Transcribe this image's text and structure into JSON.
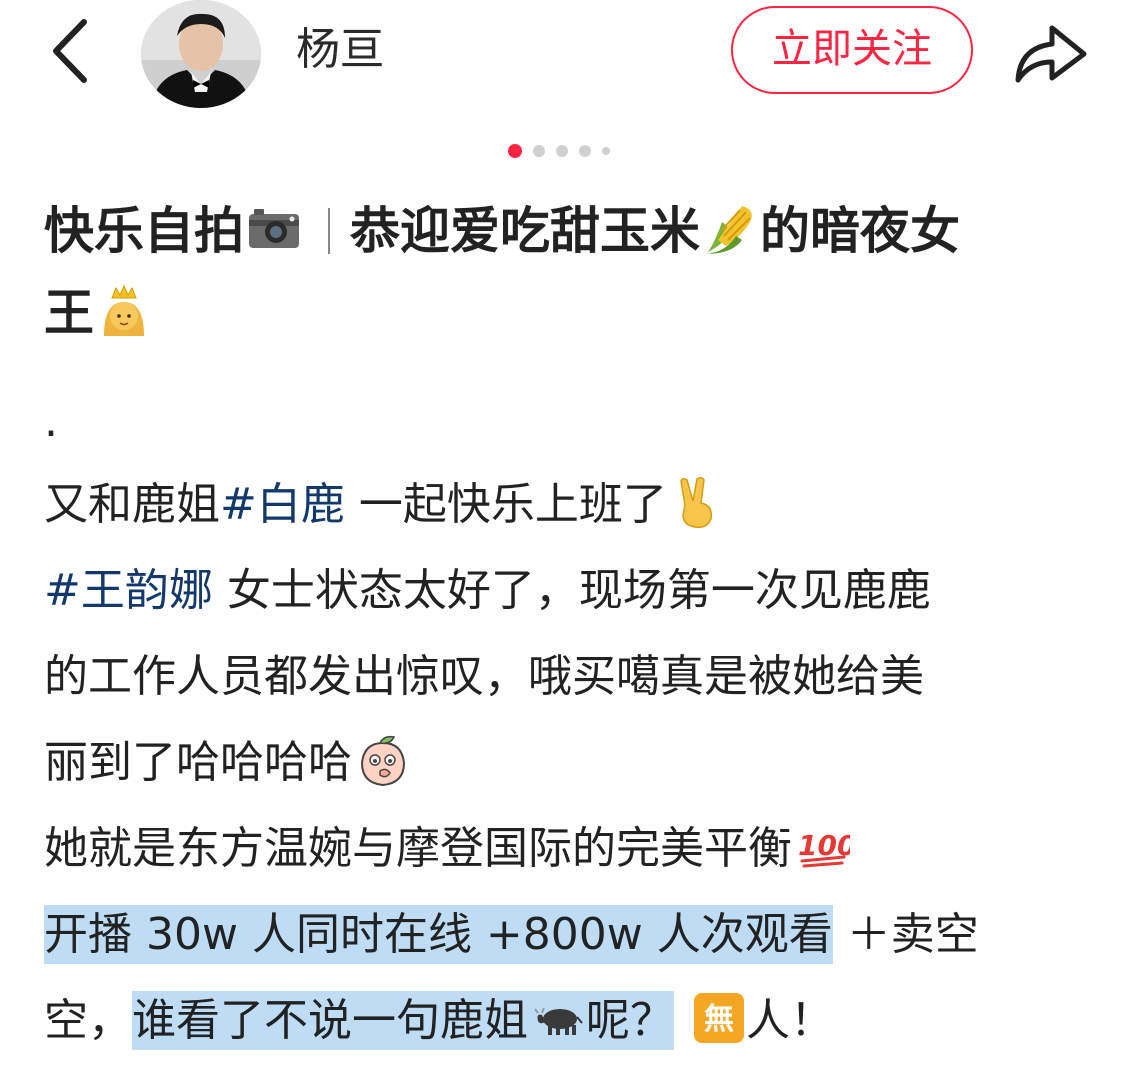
{
  "header": {
    "username": "杨亘",
    "follow_label": "立即关注"
  },
  "pager": {
    "count": 5,
    "active_index": 0
  },
  "post": {
    "title_part1": "快乐自拍",
    "title_part2": "恭迎爱吃甜玉米",
    "title_part3": "的暗夜女",
    "title_part4": "王",
    "dot": ".",
    "line1_a": "又和鹿姐",
    "line1_tag": "#白鹿",
    "line1_b": " 一起快乐上班了",
    "line2_tag": "#王韵娜",
    "line2_b": " 女士状态太好了，现场第一次见鹿鹿",
    "line3": "的工作人员都发出惊叹，哦买噶真是被她给美",
    "line4": "丽到了哈哈哈哈",
    "line5": "她就是东方温婉与摩登国际的完美平衡",
    "line6_hl": "开播 30w 人同时在线 +800w 人次观看",
    "line6_b": "＋卖空",
    "line7_a": "空，",
    "line7_hl": "谁看了不说一句鹿姐",
    "line7_hl2": "呢？",
    "line7_c": "人！",
    "emoji_icons": [
      "camera-icon",
      "corn-icon",
      "princess-icon",
      "victory-hand-icon",
      "peach-face-icon",
      "hundred-points-icon",
      "ox-icon",
      "wu-sign-icon"
    ]
  },
  "colors": {
    "accent": "#ff2442",
    "hashtag": "#13386c",
    "highlight": "#bfdcf5"
  }
}
